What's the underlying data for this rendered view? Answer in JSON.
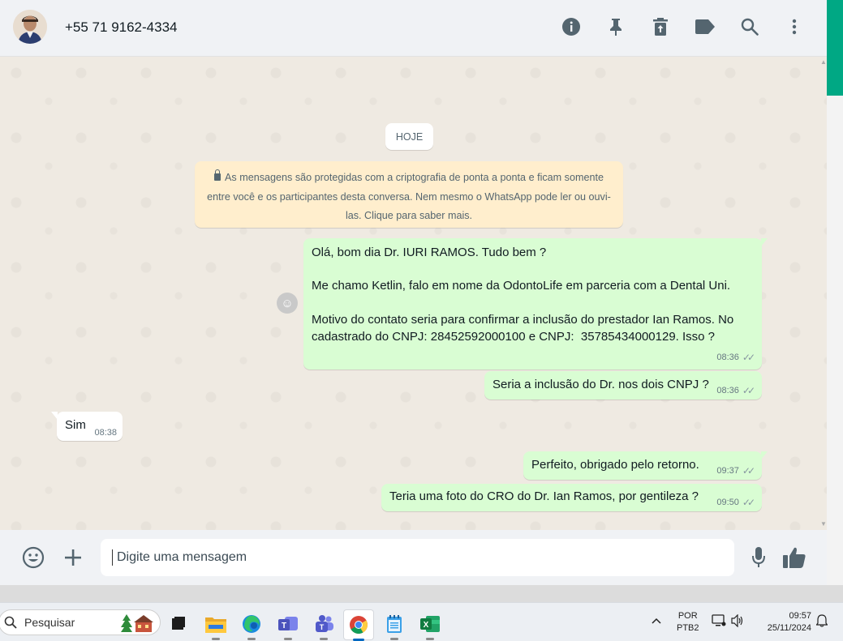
{
  "header": {
    "contact_name": "+55 71 9162-4334",
    "icons": [
      "info-icon",
      "pin-icon",
      "delete-icon",
      "label-icon",
      "search-icon",
      "menu-icon"
    ]
  },
  "chat": {
    "date_label": "HOJE",
    "encryption_notice": "As mensagens são protegidas com a criptografia de ponta a ponta e ficam somente entre você e os participantes desta conversa. Nem mesmo o WhatsApp pode ler ou ouvi-las. Clique para saber mais.",
    "messages": [
      {
        "direction": "out",
        "text": "Olá, bom dia Dr. IURI RAMOS. Tudo bem ?\n\nMe chamo Ketlin, falo em nome da OdontoLife em parceria com a Dental Uni.\n\nMotivo do contato seria para confirmar a inclusão do prestador Ian Ramos. No cadastrado do CNPJ: 28452592000100 e CNPJ:  35785434000129. Isso ?",
        "time": "08:36"
      },
      {
        "direction": "out",
        "text": "Seria a inclusão do Dr. nos dois CNPJ ?",
        "time": "08:36"
      },
      {
        "direction": "in",
        "text": "Sim",
        "time": "08:38"
      },
      {
        "direction": "out",
        "text": "Perfeito, obrigado pelo retorno.",
        "time": "09:37"
      },
      {
        "direction": "out",
        "text": "Teria uma foto do CRO do Dr.  Ian Ramos, por gentileza ?",
        "time": "09:50"
      }
    ]
  },
  "composer": {
    "placeholder": "Digite uma mensagem"
  },
  "taskbar": {
    "search_label": "Pesquisar",
    "language_line1": "POR",
    "language_line2": "PTB2",
    "time": "09:57",
    "date": "25/11/2024"
  },
  "colors": {
    "outgoing_bubble": "#d9fdd3",
    "incoming_bubble": "#ffffff",
    "system_notice": "#ffeecd",
    "accent": "#00a884"
  }
}
